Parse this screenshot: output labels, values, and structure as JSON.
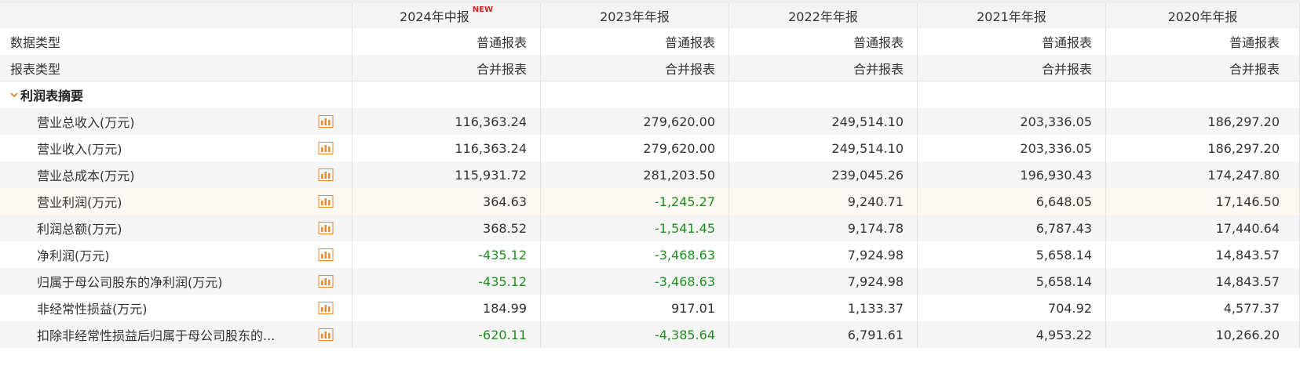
{
  "header": {
    "columns": [
      "2024年中报",
      "2023年年报",
      "2022年年报",
      "2021年年报",
      "2020年年报"
    ],
    "new_badge": "NEW"
  },
  "meta_rows": [
    {
      "label": "数据类型",
      "values": [
        "普通报表",
        "普通报表",
        "普通报表",
        "普通报表",
        "普通报表"
      ]
    },
    {
      "label": "报表类型",
      "values": [
        "合并报表",
        "合并报表",
        "合并报表",
        "合并报表",
        "合并报表"
      ]
    }
  ],
  "section": {
    "title": "利润表摘要",
    "chevron_icon": "chevron-down-icon"
  },
  "rows": [
    {
      "label": "营业总收入(万元)",
      "values": [
        "116,363.24",
        "279,620.00",
        "249,514.10",
        "203,336.05",
        "186,297.20"
      ]
    },
    {
      "label": "营业收入(万元)",
      "values": [
        "116,363.24",
        "279,620.00",
        "249,514.10",
        "203,336.05",
        "186,297.20"
      ]
    },
    {
      "label": "营业总成本(万元)",
      "values": [
        "115,931.72",
        "281,203.50",
        "239,045.26",
        "196,930.43",
        "174,247.80"
      ]
    },
    {
      "label": "营业利润(万元)",
      "values": [
        "364.63",
        "-1,245.27",
        "9,240.71",
        "6,648.05",
        "17,146.50"
      ]
    },
    {
      "label": "利润总额(万元)",
      "values": [
        "368.52",
        "-1,541.45",
        "9,174.78",
        "6,787.43",
        "17,440.64"
      ]
    },
    {
      "label": "净利润(万元)",
      "values": [
        "-435.12",
        "-3,468.63",
        "7,924.98",
        "5,658.14",
        "14,843.57"
      ]
    },
    {
      "label": "归属于母公司股东的净利润(万元)",
      "values": [
        "-435.12",
        "-3,468.63",
        "7,924.98",
        "5,658.14",
        "14,843.57"
      ]
    },
    {
      "label": "非经常性损益(万元)",
      "values": [
        "184.99",
        "917.01",
        "1,133.37",
        "704.92",
        "4,577.37"
      ]
    },
    {
      "label": "扣除非经常性损益后归属于母公司股东的...",
      "values": [
        "-620.11",
        "-4,385.64",
        "6,791.61",
        "4,953.22",
        "10,266.20"
      ]
    }
  ],
  "colors": {
    "negative": "#1d8f1d",
    "new_badge": "#e02020",
    "chart_icon": "#f08a24",
    "highlight_row": "#fff8f2"
  },
  "chart_icon_name": "bar-chart-icon"
}
